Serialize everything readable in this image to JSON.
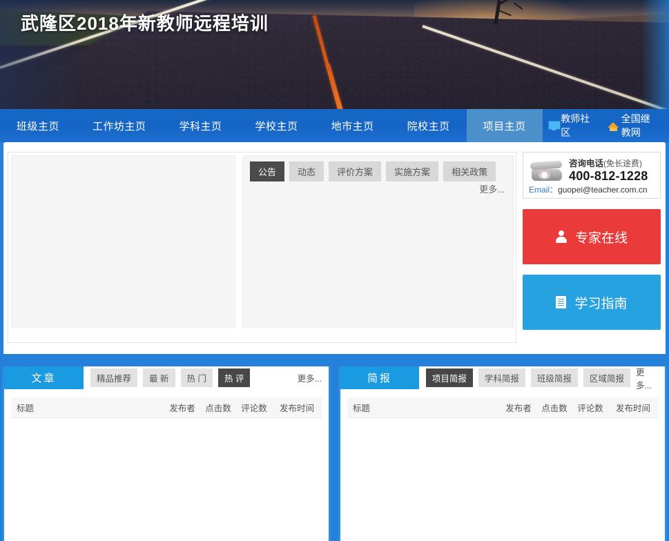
{
  "banner": {
    "title": "武隆区2018年新教师远程培训"
  },
  "nav": {
    "items": [
      {
        "label": "班级主页",
        "active": false
      },
      {
        "label": "工作坊主页",
        "active": false
      },
      {
        "label": "学科主页",
        "active": false
      },
      {
        "label": "学校主页",
        "active": false
      },
      {
        "label": "地市主页",
        "active": false
      },
      {
        "label": "院校主页",
        "active": false
      },
      {
        "label": "项目主页",
        "active": true
      }
    ],
    "links": [
      {
        "label": "教师社区",
        "icon": "monitor-icon"
      },
      {
        "label": "全国继教网",
        "icon": "house-icon"
      }
    ],
    "bg_color": "#1565c6",
    "active_color": "#4b8fcb"
  },
  "content": {
    "tabs": [
      {
        "label": "公告",
        "active": true
      },
      {
        "label": "动态",
        "active": false
      },
      {
        "label": "评价方案",
        "active": false
      },
      {
        "label": "实施方案",
        "active": false
      },
      {
        "label": "相关政策",
        "active": false
      }
    ],
    "more_label": "更多..."
  },
  "sidebar": {
    "contact": {
      "phone_label": "咨询电话",
      "phone_note": "(免长途费)",
      "phone_number": "400-812-1228",
      "email_label": "Email：",
      "email_value": "guopei@teacher.com.cn",
      "phone_icon": "telephone-icon"
    },
    "buttons": [
      {
        "label": "专家在线",
        "icon": "person-icon",
        "color": "#ea3a3a"
      },
      {
        "label": "学习指南",
        "icon": "document-icon",
        "color": "#27a2e0"
      }
    ]
  },
  "panels": [
    {
      "title": "文章",
      "tabs": [
        {
          "label": "精品推荐",
          "active": false
        },
        {
          "label": "最 新",
          "active": false
        },
        {
          "label": "热 门",
          "active": false
        },
        {
          "label": "热 评",
          "active": true
        }
      ],
      "more_label": "更多...",
      "columns": [
        "标题",
        "发布者",
        "点击数",
        "评论数",
        "发布时间"
      ],
      "rows": []
    },
    {
      "title": "简报",
      "tabs": [
        {
          "label": "项目简报",
          "active": true
        },
        {
          "label": "学科简报",
          "active": false
        },
        {
          "label": "班级简报",
          "active": false
        },
        {
          "label": "区域简报",
          "active": false
        }
      ],
      "more_label": "更多...",
      "columns": [
        "标题",
        "发布者",
        "点击数",
        "评论数",
        "发布时间"
      ],
      "rows": []
    }
  ]
}
